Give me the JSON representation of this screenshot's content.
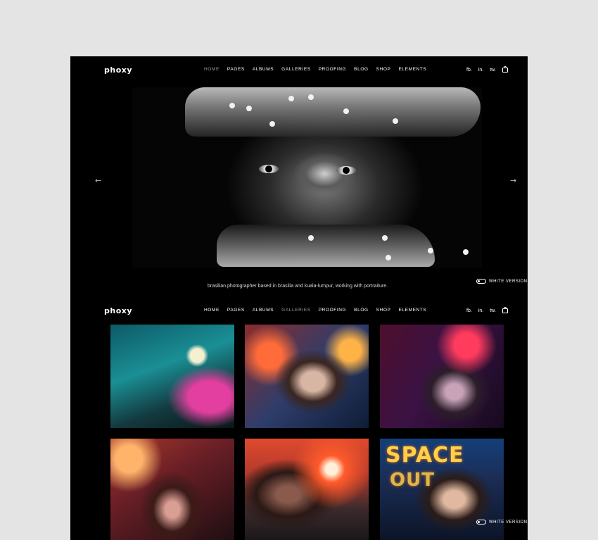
{
  "brand": "phoxy",
  "nav_top": {
    "menu": [
      "HOME",
      "PAGES",
      "ALBUMS",
      "GALLERIES",
      "PROOFING",
      "BLOG",
      "SHOP",
      "ELEMENTS"
    ],
    "active": "HOME",
    "social": [
      "fb.",
      "in.",
      "tw."
    ],
    "cart_icon": "bag-icon"
  },
  "hero": {
    "caption": "brasilian photographer based in brasilia and kuala-lumpur, working with portraiture.",
    "prev_arrow": "←",
    "next_arrow": "→"
  },
  "toggle_top": {
    "label": "WHITE VERSION"
  },
  "nav_gallery": {
    "menu": [
      "HOME",
      "PAGES",
      "ALBUMS",
      "GALLERIES",
      "PROOFING",
      "BLOG",
      "SHOP",
      "ELEMENTS"
    ],
    "active": "GALLERIES",
    "social": [
      "fb.",
      "in.",
      "tw."
    ]
  },
  "gallery": {
    "sign_text_1": "SPACE",
    "sign_text_2": "OUT"
  },
  "toggle_bottom": {
    "label": "WHITE VERSION"
  }
}
